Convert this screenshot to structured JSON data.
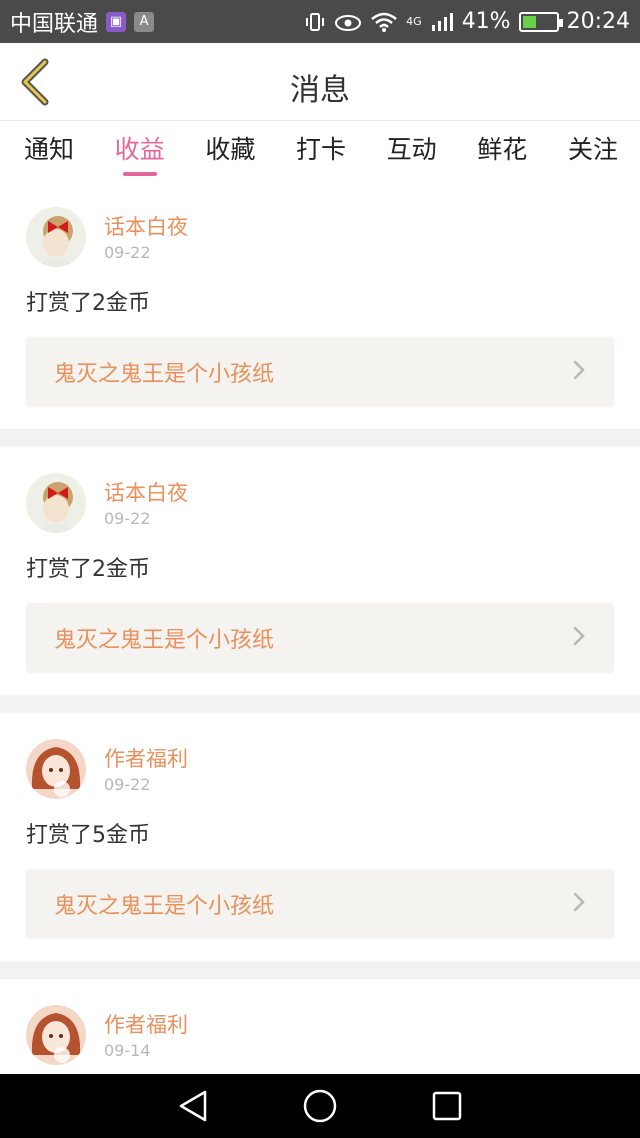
{
  "status_bar": {
    "carrier": "中国联通",
    "network": "4G",
    "battery_percent": "41%",
    "time": "20:24",
    "battery_level": 0.41
  },
  "header": {
    "title": "消息",
    "back_icon": "chevron-left-icon",
    "accent": "#e8c84a"
  },
  "tabs": [
    {
      "label": "通知",
      "active": false
    },
    {
      "label": "收益",
      "active": true
    },
    {
      "label": "收藏",
      "active": false
    },
    {
      "label": "打卡",
      "active": false
    },
    {
      "label": "互动",
      "active": false
    },
    {
      "label": "鲜花",
      "active": false
    },
    {
      "label": "关注",
      "active": false
    }
  ],
  "feed": [
    {
      "user": "话本白夜",
      "date": "09-22",
      "message": "打赏了2金币",
      "link": "鬼灭之鬼王是个小孩纸",
      "avatar": "avatar-girl-bow"
    },
    {
      "user": "话本白夜",
      "date": "09-22",
      "message": "打赏了2金币",
      "link": "鬼灭之鬼王是个小孩纸",
      "avatar": "avatar-girl-bow"
    },
    {
      "user": "作者福利",
      "date": "09-22",
      "message": "打赏了5金币",
      "link": "鬼灭之鬼王是个小孩纸",
      "avatar": "avatar-anime-girl"
    },
    {
      "user": "作者福利",
      "date": "09-14",
      "avatar": "avatar-anime-girl"
    }
  ],
  "colors": {
    "active_tab": "#e3679b",
    "name_text": "#e8915c",
    "link_bg": "#f4f3ef"
  }
}
